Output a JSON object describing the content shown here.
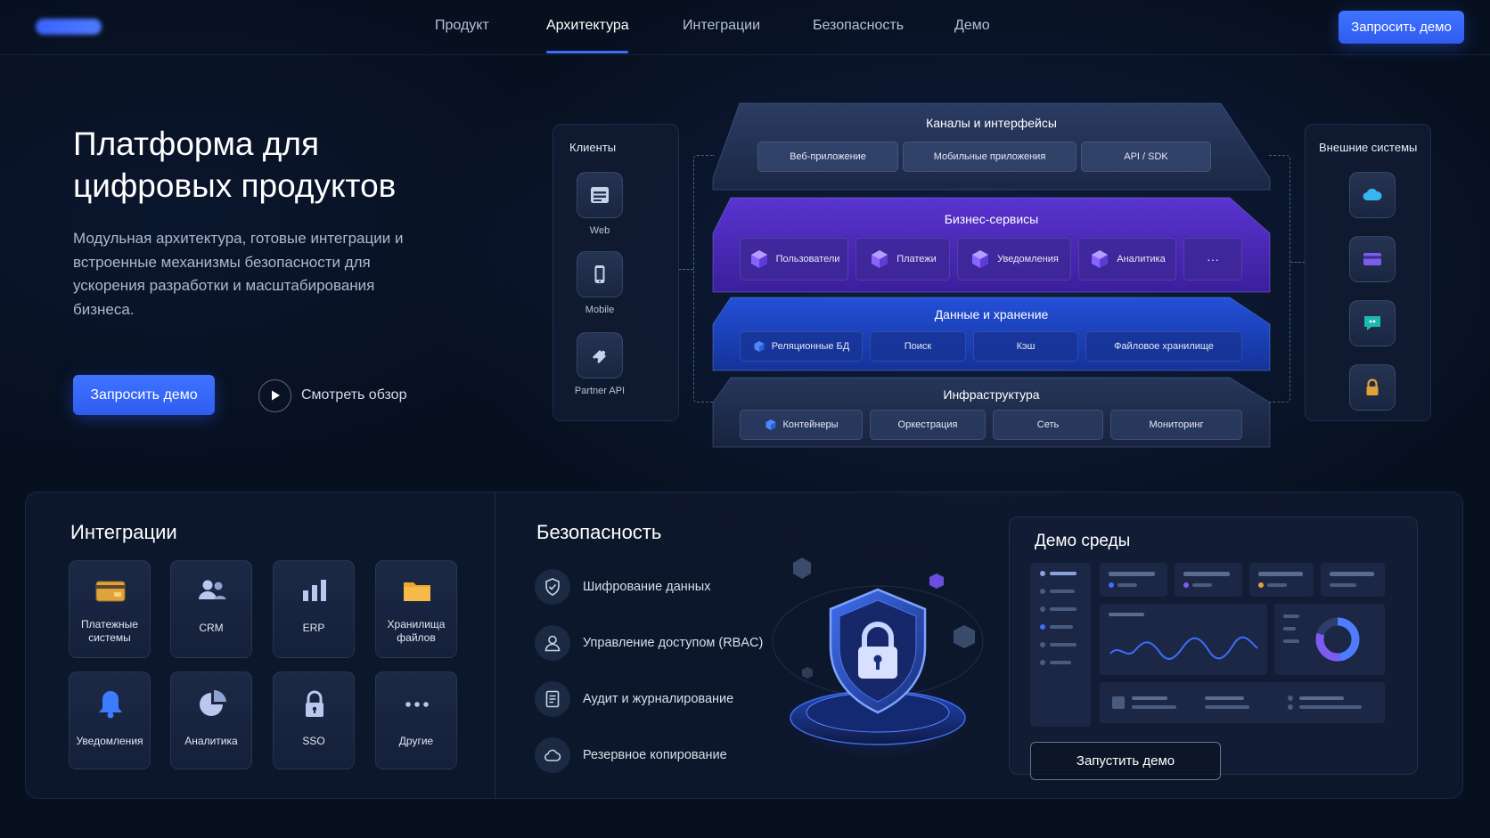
{
  "nav": {
    "links": [
      "Продукт",
      "Архитектура",
      "Интеграции",
      "Безопасность",
      "Демо"
    ],
    "active": "Архитектура",
    "cta_label": "Запросить демо"
  },
  "hero": {
    "title": "Платформа для цифровых продуктов",
    "subtitle": "Модульная архитектура, готовые интеграции и встроенные механизмы безопасности для ускорения разработки и масштабирования бизнеса.",
    "cta_label": "Запросить демо",
    "watch_label": "Смотреть обзор"
  },
  "architecture": {
    "clients": {
      "title": "Клиенты",
      "items": [
        {
          "label": "Web",
          "icon": "browser-icon"
        },
        {
          "label": "Mobile",
          "icon": "smartphone-icon"
        },
        {
          "label": "Partner API",
          "icon": "puzzle-icon"
        }
      ]
    },
    "external": {
      "title": "Внешние системы",
      "icons": [
        "cloud-icon",
        "card-icon",
        "chat-icon",
        "lock-icon"
      ]
    },
    "layers": [
      {
        "title": "Каналы и интерфейсы",
        "items": [
          "Веб-приложение",
          "Мобильные приложения",
          "API / SDK"
        ]
      },
      {
        "title": "Бизнес-сервисы",
        "items": [
          "Пользователи",
          "Платежи",
          "Уведомления",
          "Аналитика",
          "···"
        ]
      },
      {
        "title": "Данные и хранение",
        "items": [
          "Реляционные БД",
          "Поиск",
          "Кэш",
          "Файловое хранилище"
        ]
      },
      {
        "title": "Инфраструктура",
        "items": [
          "Контейнеры",
          "Оркестрация",
          "Сеть",
          "Мониторинг"
        ]
      }
    ]
  },
  "integrations": {
    "title": "Интеграции",
    "items": [
      {
        "label": "Платежные системы",
        "icon": "card-icon"
      },
      {
        "label": "CRM",
        "icon": "users-icon"
      },
      {
        "label": "ERP",
        "icon": "bar-chart-icon"
      },
      {
        "label": "Хранилища файлов",
        "icon": "folder-icon"
      },
      {
        "label": "Уведомления",
        "icon": "bell-icon"
      },
      {
        "label": "Аналитика",
        "icon": "pie-chart-icon"
      },
      {
        "label": "SSO",
        "icon": "lock-icon"
      },
      {
        "label": "Другие",
        "icon": "more-icon"
      }
    ]
  },
  "security": {
    "title": "Безопасность",
    "items": [
      {
        "label": "Шифрование данных",
        "icon": "shield-check-icon"
      },
      {
        "label": "Управление доступом (RBAC)",
        "icon": "user-icon"
      },
      {
        "label": "Аудит и журналирование",
        "icon": "document-icon"
      },
      {
        "label": "Резервное копирование",
        "icon": "cloud-icon"
      }
    ]
  },
  "demo": {
    "title": "Демо среды",
    "button_label": "Запустить демо"
  },
  "colors": {
    "accent": "#3d6dff",
    "business_layer": "#4a2bb8",
    "data_layer": "#1d46c8",
    "background": "#07101f"
  }
}
